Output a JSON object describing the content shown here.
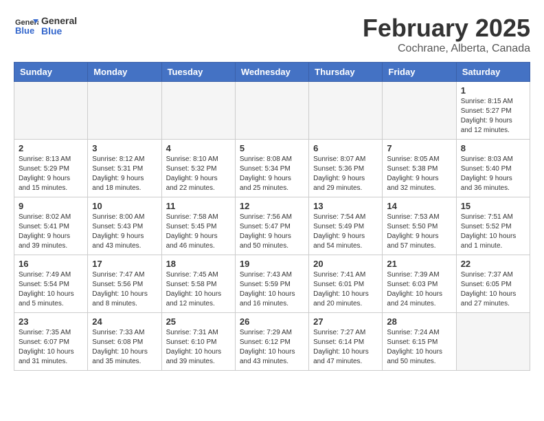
{
  "header": {
    "logo_general": "General",
    "logo_blue": "Blue",
    "month_year": "February 2025",
    "location": "Cochrane, Alberta, Canada"
  },
  "days_of_week": [
    "Sunday",
    "Monday",
    "Tuesday",
    "Wednesday",
    "Thursday",
    "Friday",
    "Saturday"
  ],
  "weeks": [
    [
      {
        "day": "",
        "info": ""
      },
      {
        "day": "",
        "info": ""
      },
      {
        "day": "",
        "info": ""
      },
      {
        "day": "",
        "info": ""
      },
      {
        "day": "",
        "info": ""
      },
      {
        "day": "",
        "info": ""
      },
      {
        "day": "1",
        "info": "Sunrise: 8:15 AM\nSunset: 5:27 PM\nDaylight: 9 hours and 12 minutes."
      }
    ],
    [
      {
        "day": "2",
        "info": "Sunrise: 8:13 AM\nSunset: 5:29 PM\nDaylight: 9 hours and 15 minutes."
      },
      {
        "day": "3",
        "info": "Sunrise: 8:12 AM\nSunset: 5:31 PM\nDaylight: 9 hours and 18 minutes."
      },
      {
        "day": "4",
        "info": "Sunrise: 8:10 AM\nSunset: 5:32 PM\nDaylight: 9 hours and 22 minutes."
      },
      {
        "day": "5",
        "info": "Sunrise: 8:08 AM\nSunset: 5:34 PM\nDaylight: 9 hours and 25 minutes."
      },
      {
        "day": "6",
        "info": "Sunrise: 8:07 AM\nSunset: 5:36 PM\nDaylight: 9 hours and 29 minutes."
      },
      {
        "day": "7",
        "info": "Sunrise: 8:05 AM\nSunset: 5:38 PM\nDaylight: 9 hours and 32 minutes."
      },
      {
        "day": "8",
        "info": "Sunrise: 8:03 AM\nSunset: 5:40 PM\nDaylight: 9 hours and 36 minutes."
      }
    ],
    [
      {
        "day": "9",
        "info": "Sunrise: 8:02 AM\nSunset: 5:41 PM\nDaylight: 9 hours and 39 minutes."
      },
      {
        "day": "10",
        "info": "Sunrise: 8:00 AM\nSunset: 5:43 PM\nDaylight: 9 hours and 43 minutes."
      },
      {
        "day": "11",
        "info": "Sunrise: 7:58 AM\nSunset: 5:45 PM\nDaylight: 9 hours and 46 minutes."
      },
      {
        "day": "12",
        "info": "Sunrise: 7:56 AM\nSunset: 5:47 PM\nDaylight: 9 hours and 50 minutes."
      },
      {
        "day": "13",
        "info": "Sunrise: 7:54 AM\nSunset: 5:49 PM\nDaylight: 9 hours and 54 minutes."
      },
      {
        "day": "14",
        "info": "Sunrise: 7:53 AM\nSunset: 5:50 PM\nDaylight: 9 hours and 57 minutes."
      },
      {
        "day": "15",
        "info": "Sunrise: 7:51 AM\nSunset: 5:52 PM\nDaylight: 10 hours and 1 minute."
      }
    ],
    [
      {
        "day": "16",
        "info": "Sunrise: 7:49 AM\nSunset: 5:54 PM\nDaylight: 10 hours and 5 minutes."
      },
      {
        "day": "17",
        "info": "Sunrise: 7:47 AM\nSunset: 5:56 PM\nDaylight: 10 hours and 8 minutes."
      },
      {
        "day": "18",
        "info": "Sunrise: 7:45 AM\nSunset: 5:58 PM\nDaylight: 10 hours and 12 minutes."
      },
      {
        "day": "19",
        "info": "Sunrise: 7:43 AM\nSunset: 5:59 PM\nDaylight: 10 hours and 16 minutes."
      },
      {
        "day": "20",
        "info": "Sunrise: 7:41 AM\nSunset: 6:01 PM\nDaylight: 10 hours and 20 minutes."
      },
      {
        "day": "21",
        "info": "Sunrise: 7:39 AM\nSunset: 6:03 PM\nDaylight: 10 hours and 24 minutes."
      },
      {
        "day": "22",
        "info": "Sunrise: 7:37 AM\nSunset: 6:05 PM\nDaylight: 10 hours and 27 minutes."
      }
    ],
    [
      {
        "day": "23",
        "info": "Sunrise: 7:35 AM\nSunset: 6:07 PM\nDaylight: 10 hours and 31 minutes."
      },
      {
        "day": "24",
        "info": "Sunrise: 7:33 AM\nSunset: 6:08 PM\nDaylight: 10 hours and 35 minutes."
      },
      {
        "day": "25",
        "info": "Sunrise: 7:31 AM\nSunset: 6:10 PM\nDaylight: 10 hours and 39 minutes."
      },
      {
        "day": "26",
        "info": "Sunrise: 7:29 AM\nSunset: 6:12 PM\nDaylight: 10 hours and 43 minutes."
      },
      {
        "day": "27",
        "info": "Sunrise: 7:27 AM\nSunset: 6:14 PM\nDaylight: 10 hours and 47 minutes."
      },
      {
        "day": "28",
        "info": "Sunrise: 7:24 AM\nSunset: 6:15 PM\nDaylight: 10 hours and 50 minutes."
      },
      {
        "day": "",
        "info": ""
      }
    ]
  ]
}
